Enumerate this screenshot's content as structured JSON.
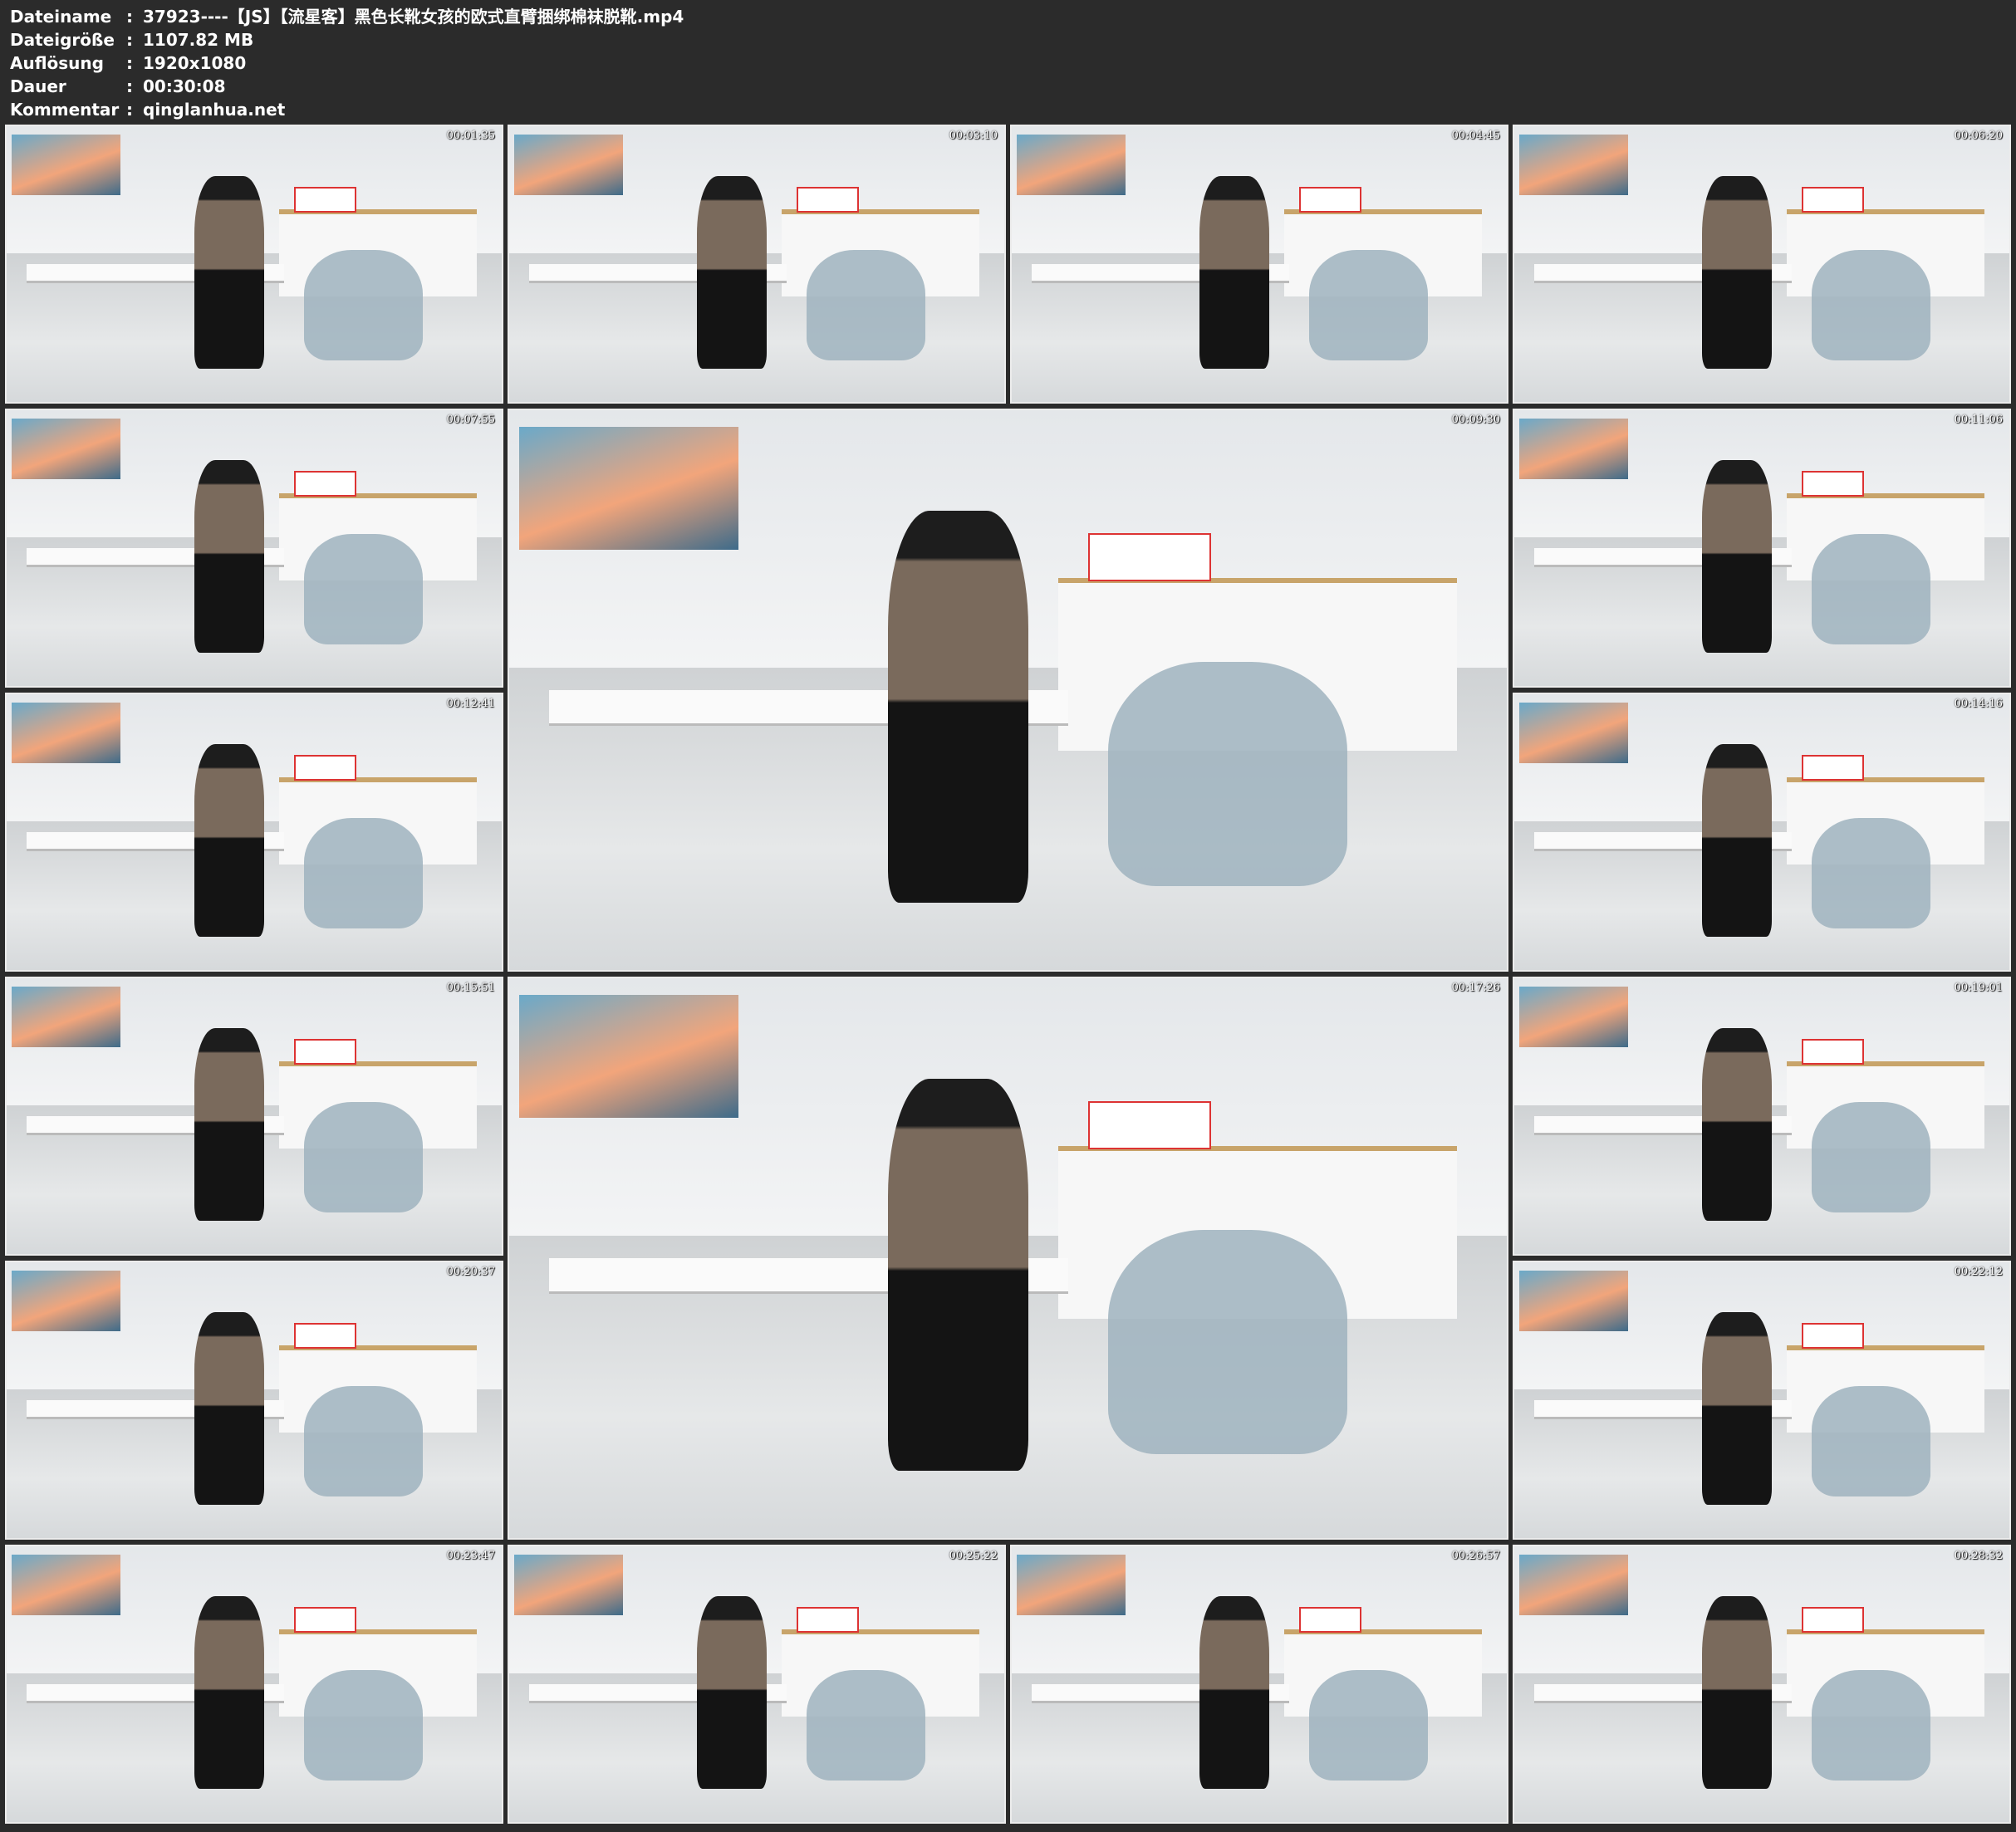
{
  "info": {
    "rows": [
      {
        "label": "Dateiname",
        "sep": ":",
        "value": "37923----【JS】【流星客】黑色长靴女孩的欧式直臂捆绑棉袜脱靴.mp4"
      },
      {
        "label": "Dateigröße",
        "sep": ":",
        "value": "1107.82 MB"
      },
      {
        "label": "Auflösung",
        "sep": ":",
        "value": "1920x1080"
      },
      {
        "label": "Dauer",
        "sep": ":",
        "value": "00:30:08"
      },
      {
        "label": "Kommentar",
        "sep": ":",
        "value": "qinglanhua.net"
      }
    ]
  },
  "thumbnails": [
    {
      "timestamp": "00:01:35",
      "scene": "standing-two"
    },
    {
      "timestamp": "00:03:10",
      "scene": "standing-two"
    },
    {
      "timestamp": "00:04:45",
      "scene": "standing-one"
    },
    {
      "timestamp": "00:06:20",
      "scene": "seated-man"
    },
    {
      "timestamp": "00:07:55",
      "scene": "seated-man"
    },
    {
      "timestamp": "00:09:30",
      "scene": "seated-large"
    },
    {
      "timestamp": "00:11:06",
      "scene": "seated"
    },
    {
      "timestamp": "00:12:41",
      "scene": "seated"
    },
    {
      "timestamp": "00:14:16",
      "scene": "seated"
    },
    {
      "timestamp": "00:15:51",
      "scene": "seated"
    },
    {
      "timestamp": "00:17:26",
      "scene": "seated-large"
    },
    {
      "timestamp": "00:19:01",
      "scene": "seated"
    },
    {
      "timestamp": "00:20:37",
      "scene": "seated"
    },
    {
      "timestamp": "00:22:12",
      "scene": "seated"
    },
    {
      "timestamp": "00:23:47",
      "scene": "seated"
    },
    {
      "timestamp": "00:25:22",
      "scene": "seated"
    },
    {
      "timestamp": "00:26:57",
      "scene": "seated"
    },
    {
      "timestamp": "00:28:32",
      "scene": "seated"
    }
  ]
}
